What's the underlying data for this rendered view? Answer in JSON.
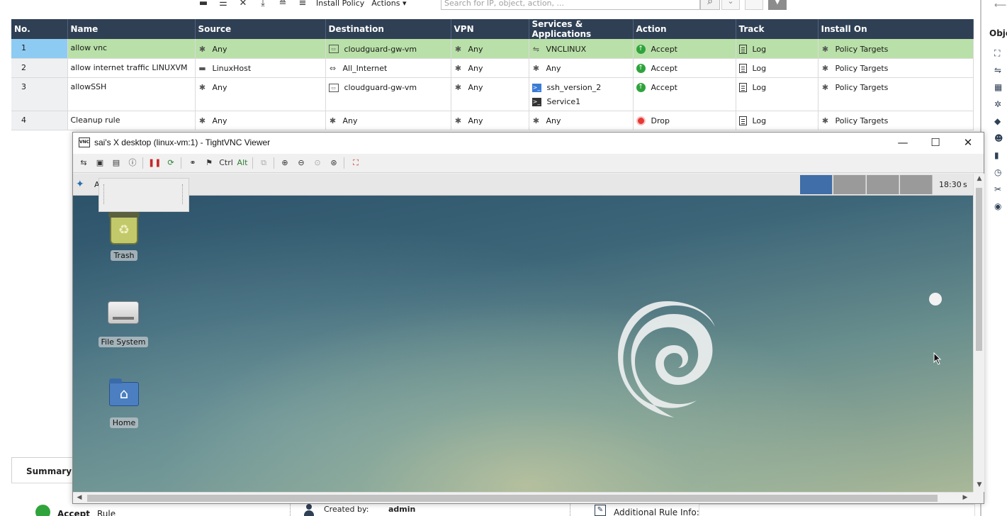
{
  "top_toolbar": {
    "install_policy": "Install Policy",
    "actions": "Actions ▾",
    "search_placeholder": "Search for IP, object, action, ..."
  },
  "rules_table": {
    "columns": [
      "No.",
      "Name",
      "Source",
      "Destination",
      "VPN",
      "Services & Applications",
      "Action",
      "Track",
      "Install On"
    ],
    "rows": [
      {
        "no": "1",
        "name": "allow vnc",
        "source": "Any",
        "destination": "cloudguard-gw-vm",
        "vpn": "Any",
        "services": [
          "VNCLINUX"
        ],
        "action": "Accept",
        "track": "Log",
        "install_on": "Policy Targets",
        "selected": true
      },
      {
        "no": "2",
        "name": "allow internet traffic LINUXVM",
        "source": "LinuxHost",
        "destination": "All_Internet",
        "vpn": "Any",
        "services": [
          "Any"
        ],
        "action": "Accept",
        "track": "Log",
        "install_on": "Policy Targets",
        "selected": false
      },
      {
        "no": "3",
        "name": "allowSSH",
        "source": "Any",
        "destination": "cloudguard-gw-vm",
        "vpn": "Any",
        "services": [
          "ssh_version_2",
          "Service1"
        ],
        "action": "Accept",
        "track": "Log",
        "install_on": "Policy Targets",
        "selected": false
      },
      {
        "no": "4",
        "name": "Cleanup rule",
        "source": "Any",
        "destination": "Any",
        "vpn": "Any",
        "services": [
          "Any"
        ],
        "action": "Drop",
        "track": "Log",
        "install_on": "Policy Targets",
        "selected": false
      }
    ]
  },
  "right_panel": {
    "title": "Obje"
  },
  "summary": {
    "tab": "Summary",
    "action": "Accept",
    "rule": "Rule",
    "created_by_label": "Created by:",
    "created_by_value": "admin",
    "additional_info_label": "Additional Rule Info:"
  },
  "vnc_window": {
    "title": "sai's X desktop (linux-vm:1) - TightVNC Viewer",
    "toolbar": {
      "ctrl": "Ctrl",
      "alt": "Alt"
    },
    "desktop": {
      "apps_label": "A",
      "clock": "18:30",
      "user": "s",
      "icons": [
        {
          "label": "Trash"
        },
        {
          "label": "File System"
        },
        {
          "label": "Home"
        }
      ]
    }
  },
  "colors": {
    "table_header": "#2f4055",
    "selected_row": "#b9e0a8",
    "selected_num": "#8ecbf2",
    "accept": "#2fa43c",
    "drop": "#e53935",
    "workspace_active": "#3f6ea8"
  }
}
